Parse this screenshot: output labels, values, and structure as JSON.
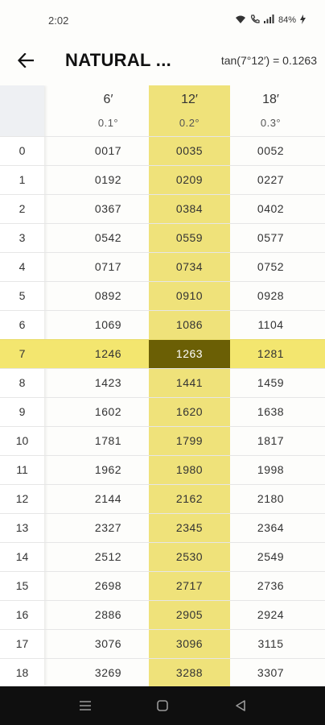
{
  "status_bar": {
    "time": "2:02",
    "battery": "84%"
  },
  "app_bar": {
    "title": "NATURAL ...",
    "formula": "tan(7°12′) = 0.1263"
  },
  "columns": [
    {
      "deg": "6′",
      "dec": "0.1°"
    },
    {
      "deg": "12′",
      "dec": "0.2°"
    },
    {
      "deg": "18′",
      "dec": "0.3°"
    }
  ],
  "selected": {
    "row_index": 7,
    "column_index": 1
  },
  "rows": [
    {
      "label": "0",
      "values": [
        "0017",
        "0035",
        "0052"
      ]
    },
    {
      "label": "1",
      "values": [
        "0192",
        "0209",
        "0227"
      ]
    },
    {
      "label": "2",
      "values": [
        "0367",
        "0384",
        "0402"
      ]
    },
    {
      "label": "3",
      "values": [
        "0542",
        "0559",
        "0577"
      ]
    },
    {
      "label": "4",
      "values": [
        "0717",
        "0734",
        "0752"
      ]
    },
    {
      "label": "5",
      "values": [
        "0892",
        "0910",
        "0928"
      ]
    },
    {
      "label": "6",
      "values": [
        "1069",
        "1086",
        "1104"
      ]
    },
    {
      "label": "7",
      "values": [
        "1246",
        "1263",
        "1281"
      ]
    },
    {
      "label": "8",
      "values": [
        "1423",
        "1441",
        "1459"
      ]
    },
    {
      "label": "9",
      "values": [
        "1602",
        "1620",
        "1638"
      ]
    },
    {
      "label": "10",
      "values": [
        "1781",
        "1799",
        "1817"
      ]
    },
    {
      "label": "11",
      "values": [
        "1962",
        "1980",
        "1998"
      ]
    },
    {
      "label": "12",
      "values": [
        "2144",
        "2162",
        "2180"
      ]
    },
    {
      "label": "13",
      "values": [
        "2327",
        "2345",
        "2364"
      ]
    },
    {
      "label": "14",
      "values": [
        "2512",
        "2530",
        "2549"
      ]
    },
    {
      "label": "15",
      "values": [
        "2698",
        "2717",
        "2736"
      ]
    },
    {
      "label": "16",
      "values": [
        "2886",
        "2905",
        "2924"
      ]
    },
    {
      "label": "17",
      "values": [
        "3076",
        "3096",
        "3115"
      ]
    },
    {
      "label": "18",
      "values": [
        "3269",
        "3288",
        "3307"
      ]
    }
  ],
  "colors": {
    "selected_column": "#efe27a",
    "selected_row": "#f3e66f",
    "selected_cell": "#6b5f05"
  },
  "icons": [
    "back-arrow-icon",
    "wifi-icon",
    "call-icon",
    "signal-icon",
    "battery-icon",
    "menu-icon",
    "home-icon",
    "back-icon"
  ]
}
